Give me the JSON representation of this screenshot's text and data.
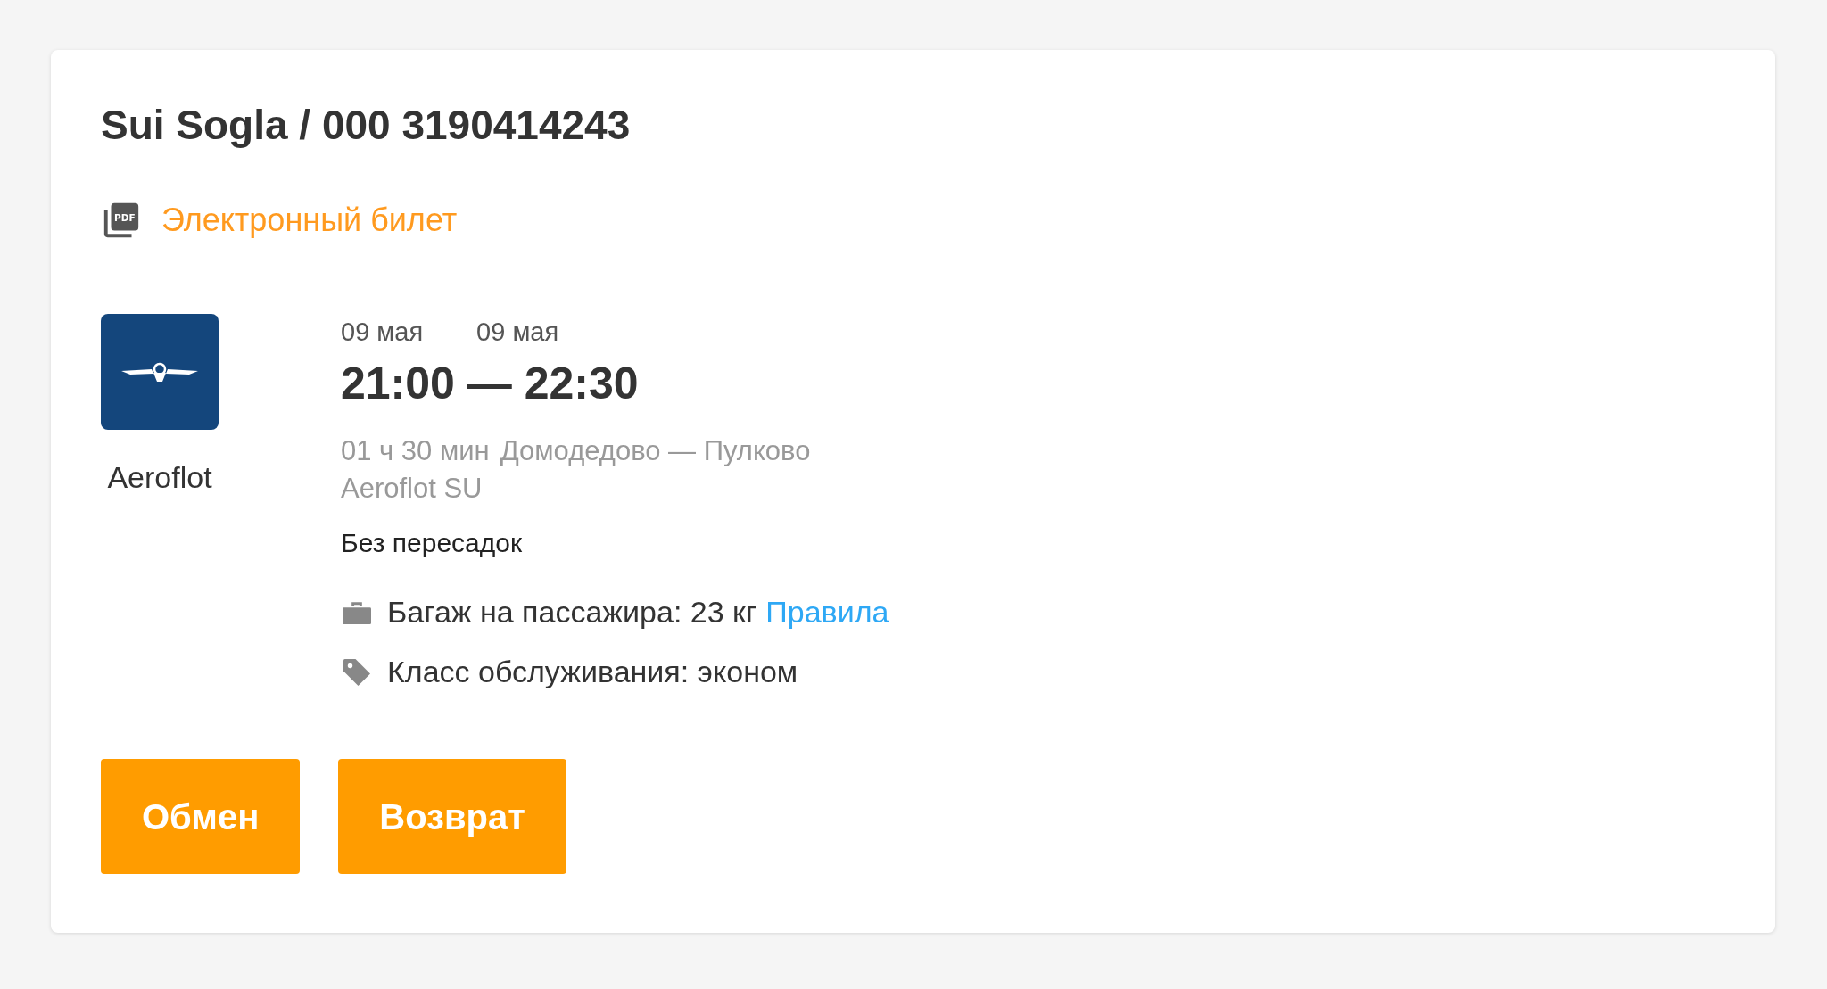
{
  "booking": {
    "title": "Sui Sogla / 000 3190414243"
  },
  "eticket_link": {
    "icon_text": "PDF",
    "label": "Электронный билет"
  },
  "airline": {
    "name": "Aeroflot"
  },
  "flight": {
    "departure_date": "09 мая",
    "arrival_date": "09 мая",
    "times": "21:00 — 22:30",
    "duration": "01 ч 30 мин",
    "route": "Домодедово — Пулково",
    "carrier": "Aeroflot SU",
    "transfers": "Без пересадок"
  },
  "baggage": {
    "label": "Багаж на пассажира: 23 кг",
    "rules_link": "Правила"
  },
  "service_class": {
    "label": "Класс обслуживания: эконом"
  },
  "buttons": [
    {
      "label": "Обмен"
    },
    {
      "label": "Возврат"
    }
  ]
}
